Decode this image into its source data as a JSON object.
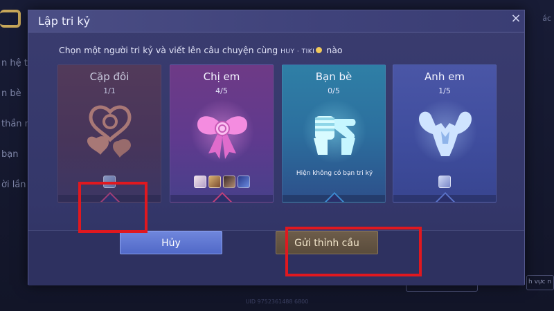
{
  "background": {
    "side_items": [
      "n hệ th",
      "n bè",
      "thần n",
      "bạn",
      "ời lần"
    ],
    "right_text": "ác",
    "right_button": "h vực n",
    "bottom_text": "UID 9752361488 6800"
  },
  "dialog": {
    "title": "Lập tri kỷ",
    "close_label": "×",
    "subtitle_prefix": "Chọn một người tri kỷ và viết lên câu chuyện cùng ",
    "subtitle_name": "HUY · TIKI",
    "subtitle_suffix": " nào"
  },
  "cards": [
    {
      "name": "Cặp đôi",
      "count": "1/1",
      "avatar_count": 1,
      "note": "",
      "color": "#5a3a55"
    },
    {
      "name": "Chị em",
      "count": "4/5",
      "avatar_count": 4,
      "note": "",
      "color": "#6e3a86"
    },
    {
      "name": "Bạn bè",
      "count": "0/5",
      "avatar_count": 0,
      "note": "Hiện không có bạn tri kỷ",
      "color": "#2f7fa6"
    },
    {
      "name": "Anh em",
      "count": "1/5",
      "avatar_count": 1,
      "note": "",
      "color": "#4a56a6"
    }
  ],
  "buttons": {
    "cancel": "Hủy",
    "send": "Gửi thỉnh cầu"
  },
  "colors": {
    "highlight_box": "#e0181f",
    "cancel_button": "#5169c8",
    "send_button": "#5a4c3c"
  }
}
